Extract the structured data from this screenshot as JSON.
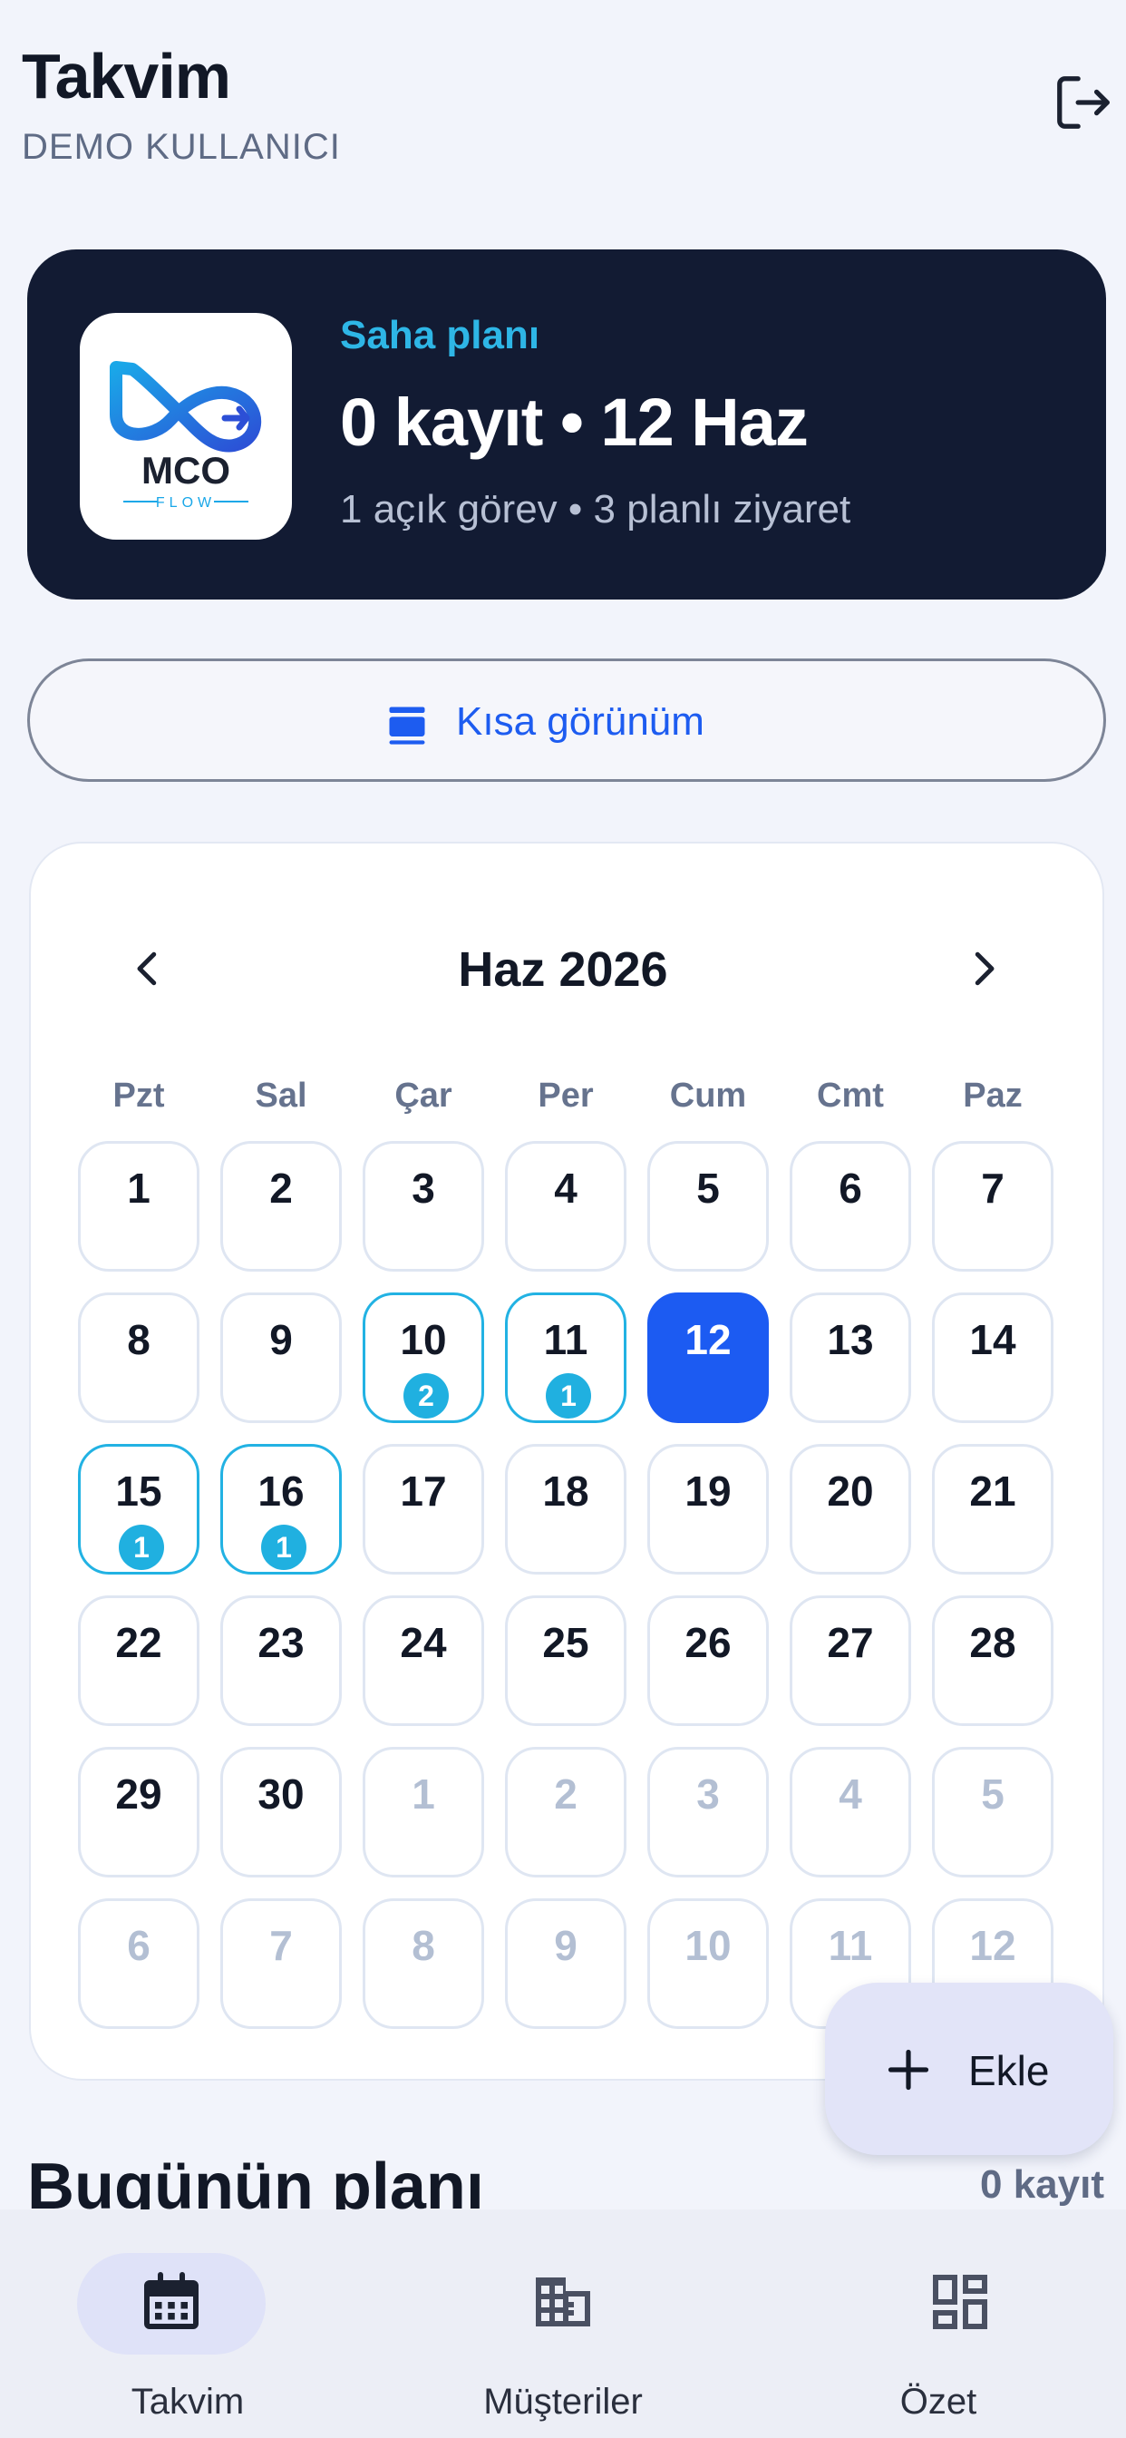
{
  "header": {
    "title": "Takvim",
    "user": "DEMO KULLANICI",
    "logout_icon": "logout-icon"
  },
  "hero": {
    "logo_text": "MCO",
    "logo_sub": "FLOW",
    "kicker": "Saha planı",
    "title": "0 kayıt • 12 Haz",
    "subtitle": "1 açık görev • 3 planlı ziyaret",
    "colors": {
      "background": "#121b33",
      "kicker": "#2eb6e6"
    }
  },
  "short_view": {
    "label": "Kısa görünüm",
    "icon": "view-agenda-icon"
  },
  "calendar": {
    "month_label": "Haz 2026",
    "weekdays": [
      "Pzt",
      "Sal",
      "Çar",
      "Per",
      "Cum",
      "Cmt",
      "Paz"
    ],
    "weeks": [
      [
        {
          "d": "1"
        },
        {
          "d": "2"
        },
        {
          "d": "3"
        },
        {
          "d": "4"
        },
        {
          "d": "5"
        },
        {
          "d": "6"
        },
        {
          "d": "7"
        }
      ],
      [
        {
          "d": "8"
        },
        {
          "d": "9"
        },
        {
          "d": "10",
          "count": "2"
        },
        {
          "d": "11",
          "count": "1"
        },
        {
          "d": "12",
          "today": true
        },
        {
          "d": "13"
        },
        {
          "d": "14"
        }
      ],
      [
        {
          "d": "15",
          "count": "1"
        },
        {
          "d": "16",
          "count": "1"
        },
        {
          "d": "17"
        },
        {
          "d": "18"
        },
        {
          "d": "19"
        },
        {
          "d": "20"
        },
        {
          "d": "21"
        }
      ],
      [
        {
          "d": "22"
        },
        {
          "d": "23"
        },
        {
          "d": "24"
        },
        {
          "d": "25"
        },
        {
          "d": "26"
        },
        {
          "d": "27"
        },
        {
          "d": "28"
        }
      ],
      [
        {
          "d": "29"
        },
        {
          "d": "30"
        },
        {
          "d": "1",
          "muted": true
        },
        {
          "d": "2",
          "muted": true
        },
        {
          "d": "3",
          "muted": true
        },
        {
          "d": "4",
          "muted": true
        },
        {
          "d": "5",
          "muted": true
        }
      ],
      [
        {
          "d": "6",
          "muted": true
        },
        {
          "d": "7",
          "muted": true
        },
        {
          "d": "8",
          "muted": true
        },
        {
          "d": "9",
          "muted": true
        },
        {
          "d": "10",
          "muted": true
        },
        {
          "d": "11",
          "muted": true
        },
        {
          "d": "12",
          "muted": true
        }
      ]
    ],
    "colors": {
      "today": "#1c5bf2",
      "event": "#20b0e0"
    }
  },
  "fab": {
    "label": "Ekle",
    "icon": "plus-icon"
  },
  "today_plan": {
    "title": "Bugünün planı",
    "count": "0 kayıt"
  },
  "bottom_nav": [
    {
      "label": "Takvim",
      "icon": "calendar-icon",
      "active": true
    },
    {
      "label": "Müşteriler",
      "icon": "building-icon",
      "active": false
    },
    {
      "label": "Özet",
      "icon": "dashboard-icon",
      "active": false
    }
  ]
}
